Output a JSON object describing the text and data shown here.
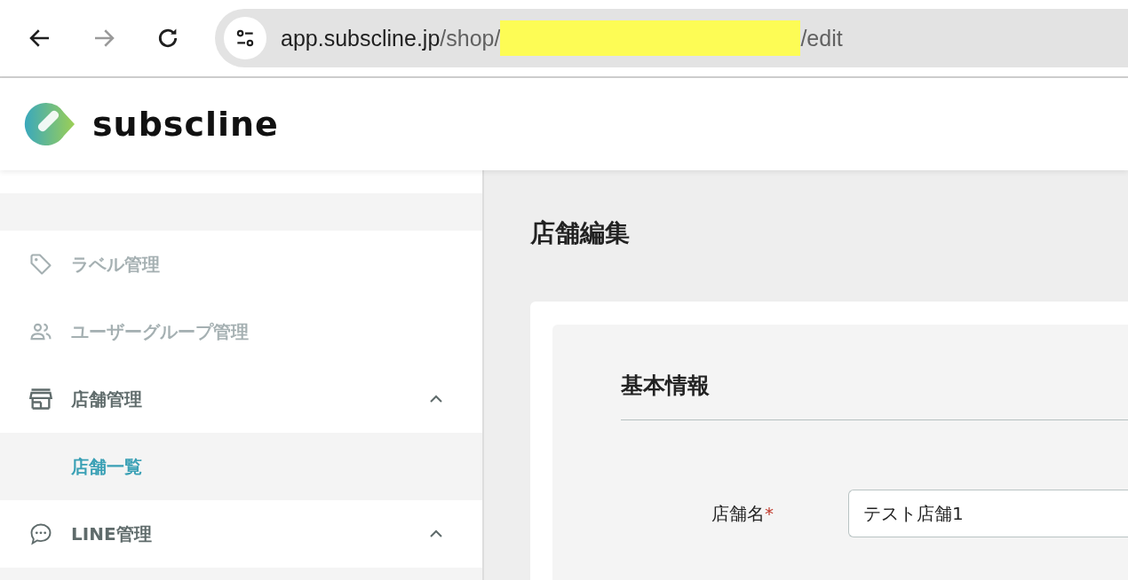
{
  "browser": {
    "back_disabled": false,
    "forward_disabled": true,
    "url": {
      "host": "app.subscline.jp",
      "path_before": "/shop/",
      "redacted": true,
      "path_after": "/edit"
    }
  },
  "header": {
    "logo_text": "subscline"
  },
  "sidebar": {
    "items": [
      {
        "kind": "item",
        "label": "ラベル管理",
        "selected": false,
        "expanded": false
      },
      {
        "kind": "item",
        "label": "ユーザーグループ管理",
        "selected": false,
        "expanded": false
      },
      {
        "kind": "group",
        "label": "店舗管理",
        "selected": false,
        "expanded": true
      },
      {
        "kind": "subitem",
        "label": "店舗一覧",
        "selected": true,
        "expanded": false
      },
      {
        "kind": "group",
        "label": "LINE管理",
        "selected": false,
        "expanded": true
      }
    ]
  },
  "page": {
    "title": "店舗編集",
    "section_title": "基本情報",
    "fields": [
      {
        "label": "店舗名",
        "required": true,
        "required_mark": "*",
        "value": "テスト店舗1"
      }
    ]
  }
}
